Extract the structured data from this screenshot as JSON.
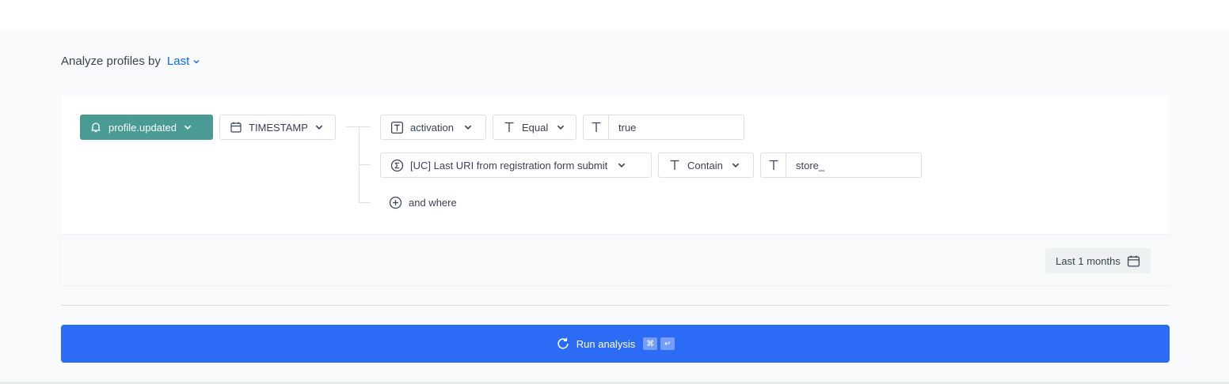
{
  "heading": {
    "label": "Analyze profiles by",
    "mode": "Last"
  },
  "event": {
    "label": "profile.updated",
    "icon": "bell-icon",
    "color": "#4a9b94"
  },
  "timestamp": {
    "label": "TIMESTAMP",
    "icon": "calendar-icon"
  },
  "conditions": [
    {
      "field": "activation",
      "field_icon": "text-type-icon",
      "operator": "Equal",
      "value": "true"
    },
    {
      "field": "[UC] Last URI from registration form submit",
      "field_icon": "sigma-icon",
      "operator": "Contain",
      "value": "store_"
    }
  ],
  "and_where": "and where",
  "date_range": "Last 1 months",
  "run": {
    "label": "Run analysis",
    "shortcut": [
      "⌘",
      "↵"
    ],
    "color": "#2c6bf5"
  },
  "accent": "#0b68ff"
}
